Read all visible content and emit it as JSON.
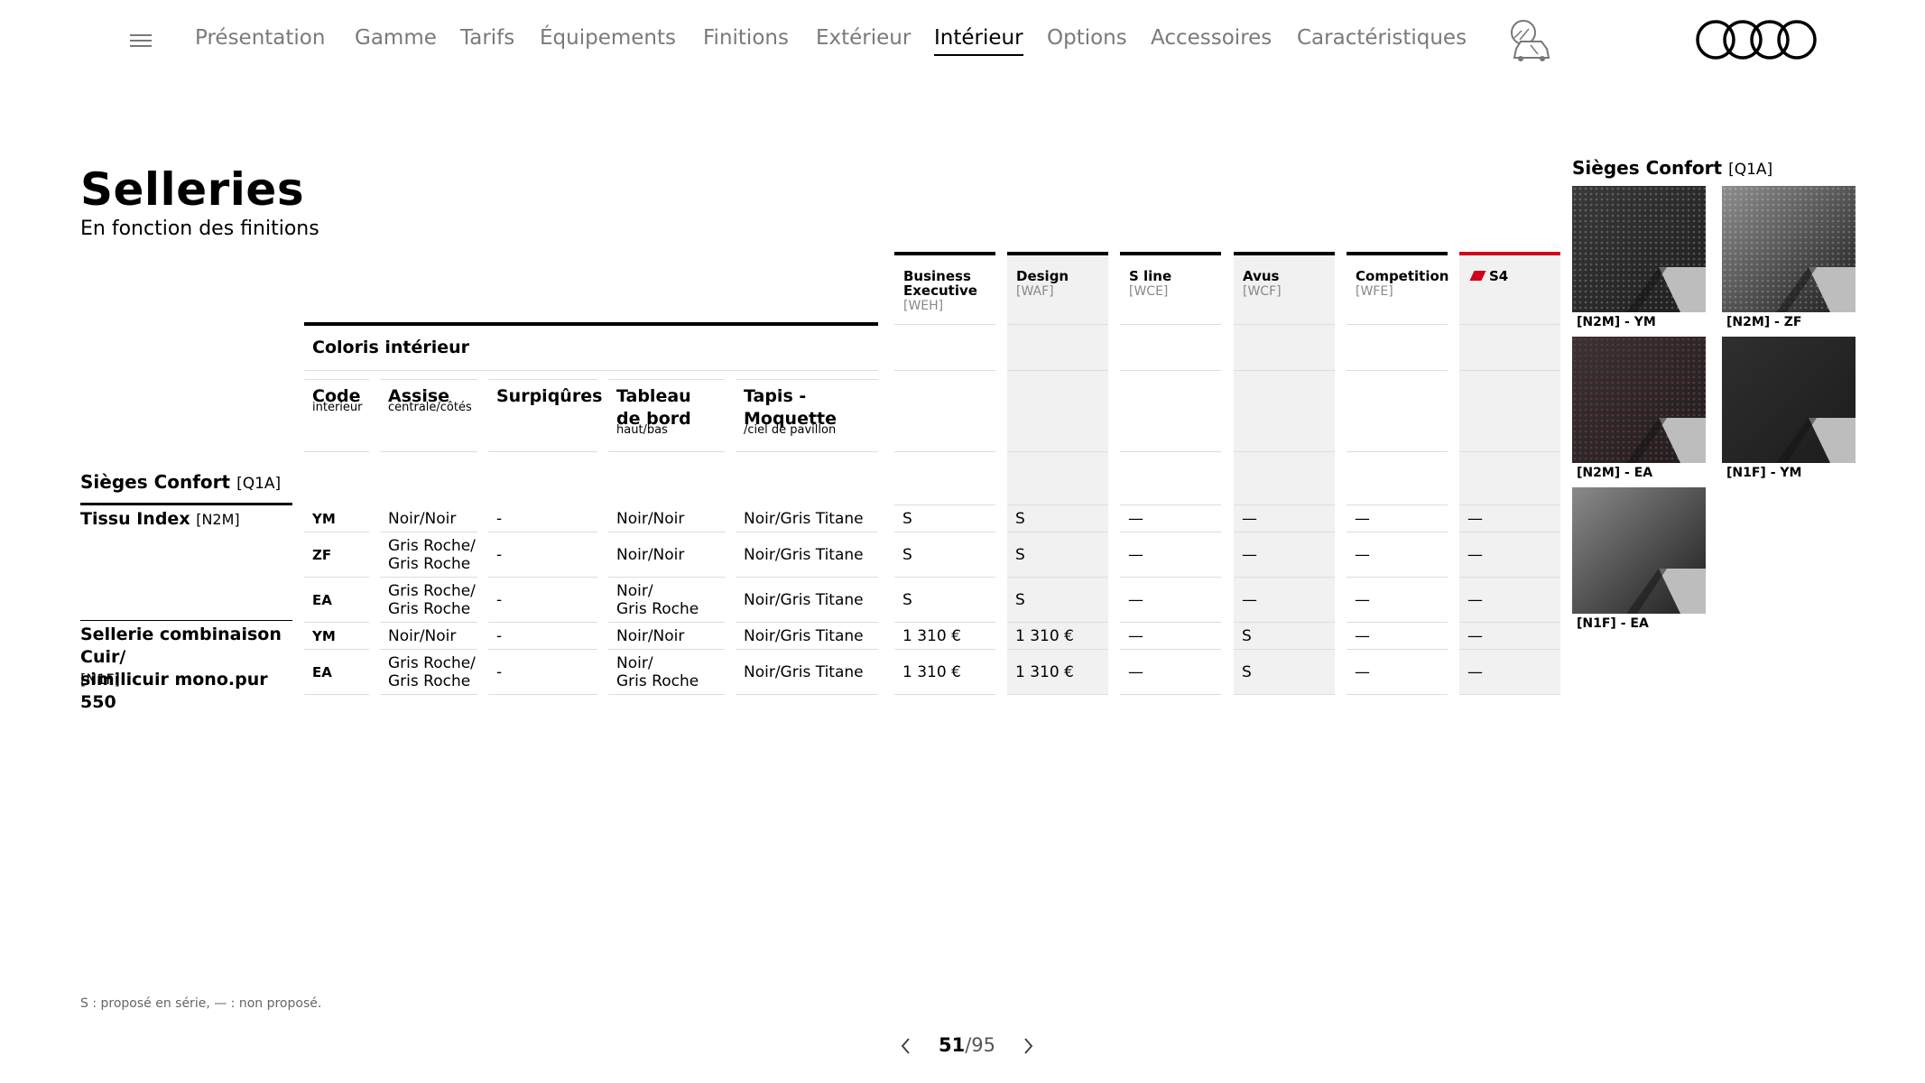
{
  "nav": {
    "items": [
      "Présentation",
      "Gamme",
      "Tarifs",
      "Équipements",
      "Finitions",
      "Extérieur",
      "Intérieur",
      "Options",
      "Accessoires",
      "Caractéristiques"
    ],
    "active": "Intérieur"
  },
  "page": {
    "title": "Selleries",
    "subtitle": "En fonction des finitions"
  },
  "trims": [
    {
      "name": "Business Executive",
      "code": "[WEH]"
    },
    {
      "name": "Design",
      "code": "[WAF]"
    },
    {
      "name": "S line",
      "code": "[WCE]"
    },
    {
      "name": "Avus",
      "code": "[WCF]"
    },
    {
      "name": "Competition",
      "code": "[WFE]"
    },
    {
      "name": "S4",
      "code": ""
    }
  ],
  "table": {
    "group_header": "Coloris intérieur",
    "columns": [
      {
        "label": "Code",
        "sub": "interieur"
      },
      {
        "label": "Assise",
        "sub": "centrale/côtés"
      },
      {
        "label": "Surpiqûres",
        "sub": ""
      },
      {
        "label": "Tableau\nde bord",
        "sub": "haut/bas"
      },
      {
        "label": "Tapis -\nMoquette",
        "sub": "/ciel de pavillon"
      }
    ],
    "section": {
      "title": "Sièges Confort",
      "code": "[Q1A]"
    },
    "groups": [
      {
        "label": "Tissu Index",
        "code": "[N2M]"
      },
      {
        "label": "Sellerie combinaison Cuir/\nsimilicuir mono.pur 550",
        "code": "[N1F]"
      }
    ],
    "rows": [
      {
        "code": "YM",
        "assise": "Noir/Noir",
        "surpiqures": "-",
        "tableau": "Noir/Noir",
        "tapis": "Noir/Gris Titane",
        "trims": [
          "S",
          "S",
          "—",
          "—",
          "—",
          "—"
        ]
      },
      {
        "code": "ZF",
        "assise": "Gris Roche/\nGris Roche",
        "surpiqures": "-",
        "tableau": "Noir/Noir",
        "tapis": "Noir/Gris Titane",
        "trims": [
          "S",
          "S",
          "—",
          "—",
          "—",
          "—"
        ]
      },
      {
        "code": "EA",
        "assise": "Gris Roche/\nGris Roche",
        "surpiqures": "-",
        "tableau": "Noir/\nGris Roche",
        "tapis": "Noir/Gris Titane",
        "trims": [
          "S",
          "S",
          "—",
          "—",
          "—",
          "—"
        ]
      },
      {
        "code": "YM",
        "assise": "Noir/Noir",
        "surpiqures": "-",
        "tableau": "Noir/Noir",
        "tapis": "Noir/Gris Titane",
        "trims": [
          "1 310 €",
          "1 310 €",
          "—",
          "S",
          "—",
          "—"
        ]
      },
      {
        "code": "EA",
        "assise": "Gris Roche/\nGris Roche",
        "surpiqures": "-",
        "tableau": "Noir/\nGris Roche",
        "tapis": "Noir/Gris Titane",
        "trims": [
          "1 310 €",
          "1 310 €",
          "—",
          "S",
          "—",
          "—"
        ]
      }
    ]
  },
  "swatches": {
    "title": "Sièges Confort",
    "code": "[Q1A]",
    "items": [
      {
        "label": "[N2M] - YM",
        "color": "#3a3a3a"
      },
      {
        "label": "[N2M] - ZF",
        "color": "#8e8e8e"
      },
      {
        "label": "[N2M] - EA",
        "color": "#3a3435"
      },
      {
        "label": "[N1F] - YM",
        "color": "#2f2f2f"
      },
      {
        "label": "[N1F] - EA",
        "color": "#8a8a8a"
      }
    ]
  },
  "footnote": "S : proposé en série, — : non proposé.",
  "pager": {
    "current": "51",
    "total": "/95"
  },
  "colors": {
    "accent": "#d0021b",
    "shade": "#f1f1f1"
  }
}
